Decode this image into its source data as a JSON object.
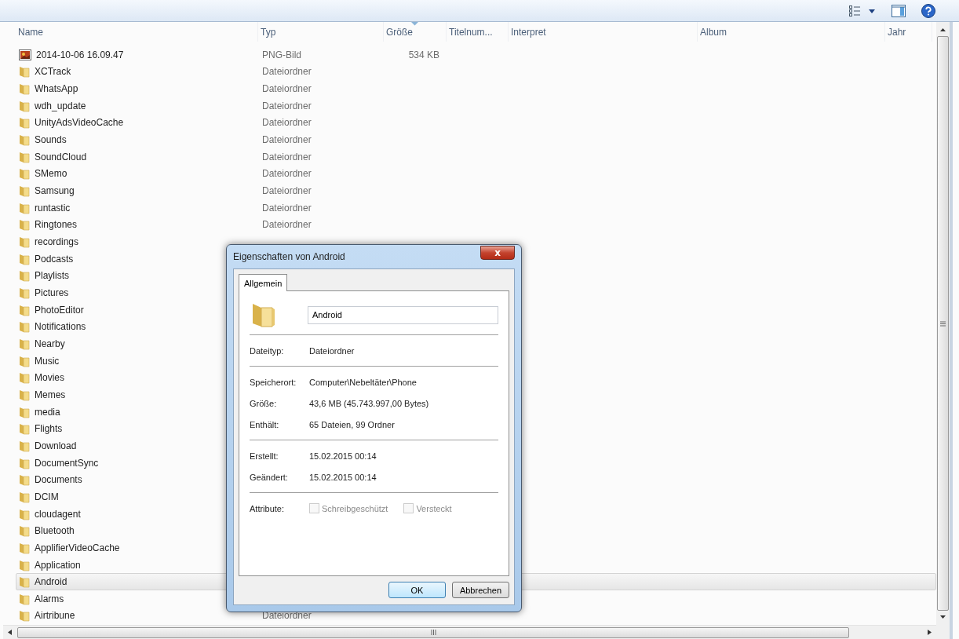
{
  "columns": [
    {
      "label": "Name",
      "sorted": false
    },
    {
      "label": "Typ",
      "sorted": false
    },
    {
      "label": "Größe",
      "sorted": true
    },
    {
      "label": "Titelnum...",
      "sorted": false
    },
    {
      "label": "Interpret",
      "sorted": false
    },
    {
      "label": "Album",
      "sorted": false
    },
    {
      "label": "Jahr",
      "sorted": false
    }
  ],
  "rows": [
    {
      "kind": "image",
      "name": "2014-10-06 16.09.47",
      "type": "PNG-Bild",
      "size": "534 KB",
      "selected": false
    },
    {
      "kind": "folder",
      "name": "XCTrack",
      "type": "Dateiordner",
      "selected": false
    },
    {
      "kind": "folder",
      "name": "WhatsApp",
      "type": "Dateiordner",
      "selected": false
    },
    {
      "kind": "folder",
      "name": "wdh_update",
      "type": "Dateiordner",
      "selected": false
    },
    {
      "kind": "folder",
      "name": "UnityAdsVideoCache",
      "type": "Dateiordner",
      "selected": false
    },
    {
      "kind": "folder",
      "name": "Sounds",
      "type": "Dateiordner",
      "selected": false
    },
    {
      "kind": "folder",
      "name": "SoundCloud",
      "type": "Dateiordner",
      "selected": false
    },
    {
      "kind": "folder",
      "name": "SMemo",
      "type": "Dateiordner",
      "selected": false
    },
    {
      "kind": "folder",
      "name": "Samsung",
      "type": "Dateiordner",
      "selected": false
    },
    {
      "kind": "folder",
      "name": "runtastic",
      "type": "Dateiordner",
      "selected": false
    },
    {
      "kind": "folder",
      "name": "Ringtones",
      "type": "Dateiordner",
      "selected": false
    },
    {
      "kind": "folder",
      "name": "recordings",
      "selected": false
    },
    {
      "kind": "folder",
      "name": "Podcasts",
      "selected": false
    },
    {
      "kind": "folder",
      "name": "Playlists",
      "selected": false
    },
    {
      "kind": "folder",
      "name": "Pictures",
      "selected": false
    },
    {
      "kind": "folder",
      "name": "PhotoEditor",
      "selected": false
    },
    {
      "kind": "folder",
      "name": "Notifications",
      "selected": false
    },
    {
      "kind": "folder",
      "name": "Nearby",
      "selected": false
    },
    {
      "kind": "folder",
      "name": "Music",
      "selected": false
    },
    {
      "kind": "folder",
      "name": "Movies",
      "selected": false
    },
    {
      "kind": "folder",
      "name": "Memes",
      "selected": false
    },
    {
      "kind": "folder",
      "name": "media",
      "selected": false
    },
    {
      "kind": "folder",
      "name": "Flights",
      "selected": false
    },
    {
      "kind": "folder",
      "name": "Download",
      "selected": false
    },
    {
      "kind": "folder",
      "name": "DocumentSync",
      "selected": false
    },
    {
      "kind": "folder",
      "name": "Documents",
      "selected": false
    },
    {
      "kind": "folder",
      "name": "DCIM",
      "selected": false
    },
    {
      "kind": "folder",
      "name": "cloudagent",
      "selected": false
    },
    {
      "kind": "folder",
      "name": "Bluetooth",
      "selected": false
    },
    {
      "kind": "folder",
      "name": "ApplifierVideoCache",
      "selected": false
    },
    {
      "kind": "folder",
      "name": "Application",
      "selected": false
    },
    {
      "kind": "folder",
      "name": "Android",
      "selected": true
    },
    {
      "kind": "folder",
      "name": "Alarms",
      "selected": false
    },
    {
      "kind": "folder",
      "name": "Airtribune",
      "type": "Dateiordner",
      "selected": false
    }
  ],
  "dialog": {
    "title": "Eigenschaften von Android",
    "close": "x",
    "tabs": [
      {
        "label": "Allgemein",
        "selected": true
      }
    ],
    "name_value": "Android",
    "sections": [
      [
        {
          "label": "Dateityp:",
          "value": "Dateiordner"
        }
      ],
      [
        {
          "label": "Speicherort:",
          "value": "Computer\\Nebeltäter\\Phone"
        },
        {
          "label": "Größe:",
          "value": "43,6 MB (45.743.997,00 Bytes)"
        },
        {
          "label": "Enthält:",
          "value": "65 Dateien, 99 Ordner"
        }
      ],
      [
        {
          "label": "Erstellt:",
          "value": "15.02.2015 00:14"
        },
        {
          "label": "Geändert:",
          "value": "15.02.2015 00:14"
        }
      ]
    ],
    "attributes_label": "Attribute:",
    "attributes": [
      {
        "label": "Schreibgeschützt",
        "checked": false,
        "disabled": true
      },
      {
        "label": "Versteckt",
        "checked": false,
        "disabled": true
      }
    ],
    "buttons": [
      {
        "label": "OK",
        "default": true
      },
      {
        "label": "Abbrechen",
        "default": false
      }
    ]
  }
}
